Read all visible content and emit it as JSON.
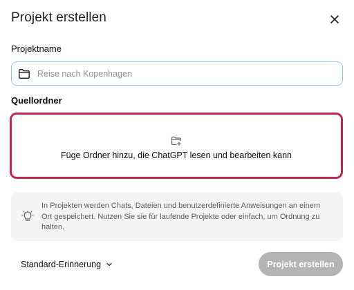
{
  "dialog": {
    "title": "Projekt erstellen",
    "close_icon": "close-icon"
  },
  "project_name": {
    "label": "Projektname",
    "icon": "folder-icon",
    "value": "",
    "placeholder": "Reise nach Kopenhagen"
  },
  "source_folder": {
    "label": "Quellordner",
    "icon": "folder-add-icon",
    "drop_text": "Füge Ordner hinzu, die ChatGPT lesen und bearbeiten kann",
    "border_color": "#c4254f"
  },
  "info": {
    "icon": "lightbulb-icon",
    "text": "In Projekten werden Chats, Dateien und benutzerdefinierte Anweisungen an einem Ort gespeichert. Nutzen Sie sie für laufende Projekte oder einfach, um Ordnung zu halten."
  },
  "footer": {
    "reminder_label": "Standard-Erinnerung",
    "reminder_icon": "chevron-down-icon",
    "create_label": "Projekt erstellen",
    "create_button_color": "#b4b4b4"
  }
}
